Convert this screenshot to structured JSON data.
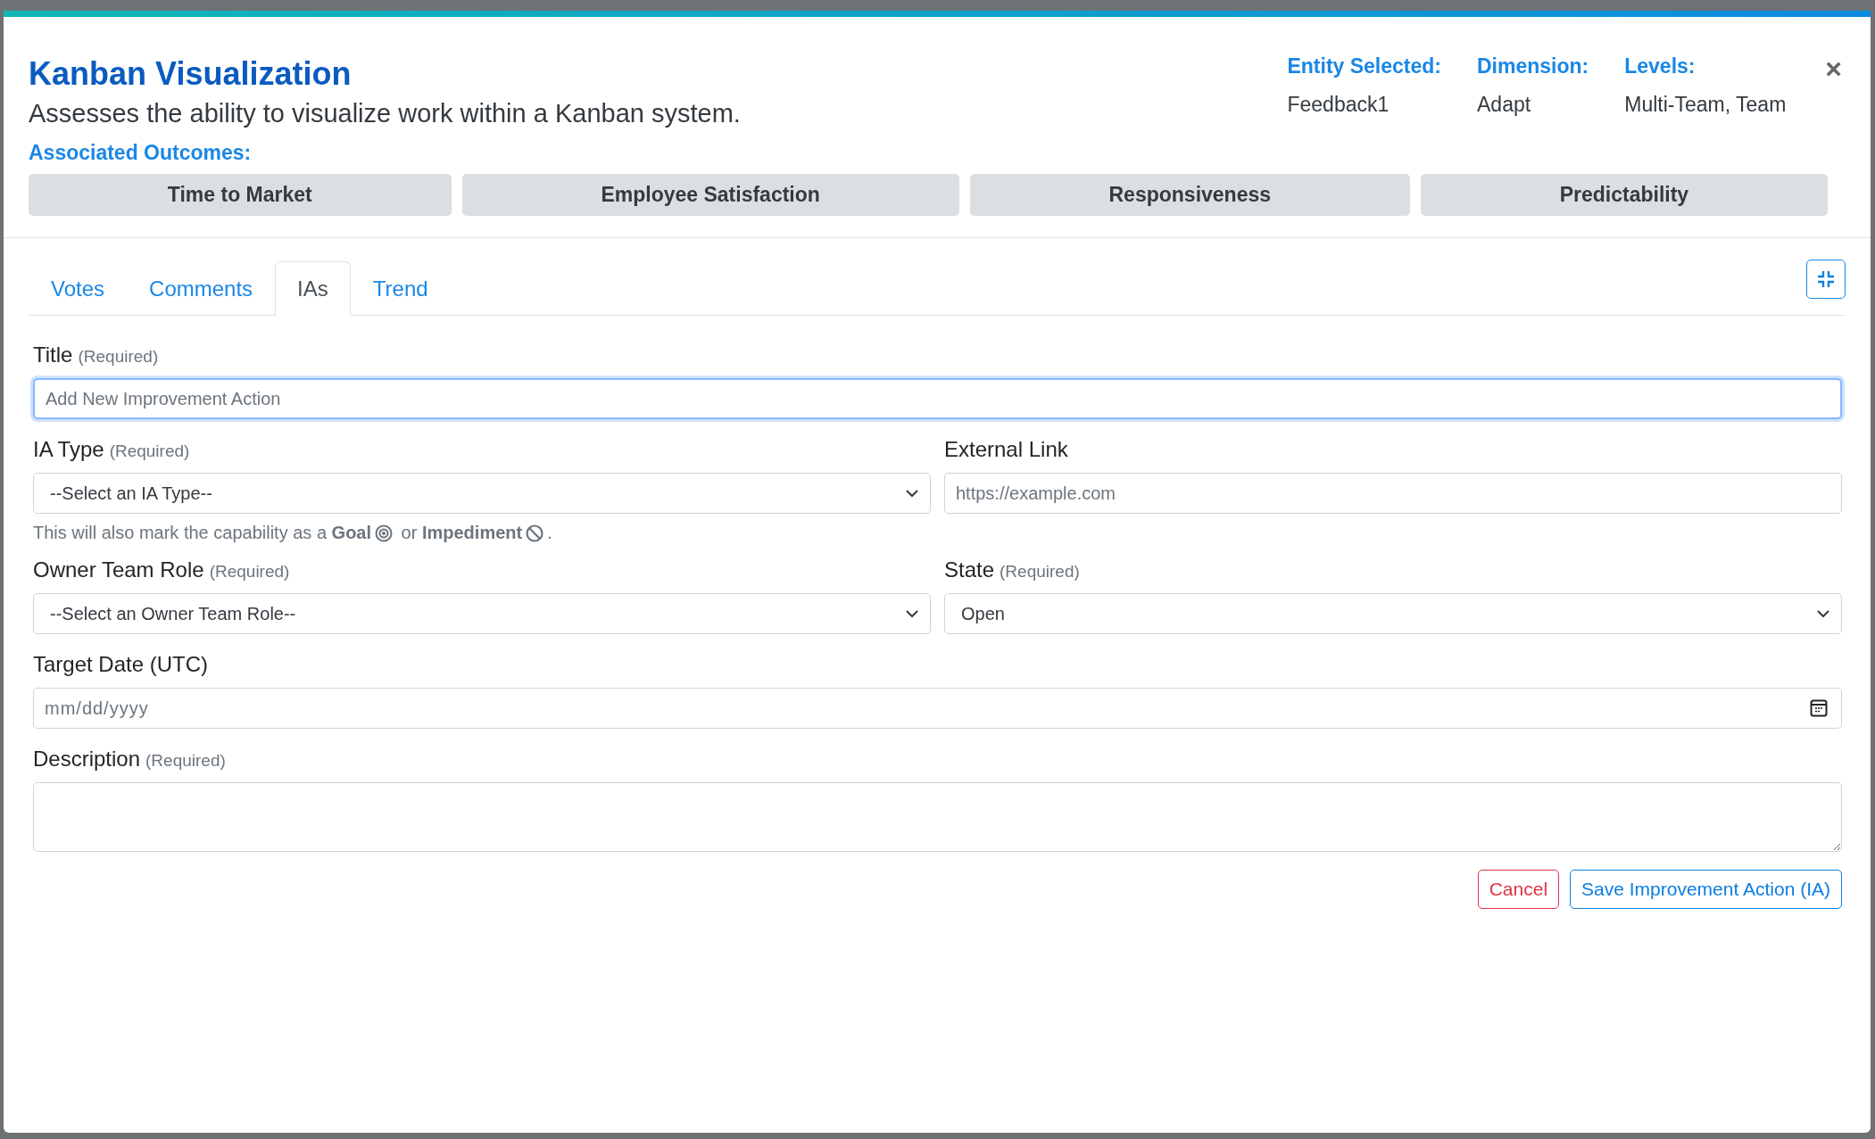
{
  "modal": {
    "title": "Kanban Visualization",
    "description": "Assesses the ability to visualize work within a Kanban system.",
    "outcomes_label": "Associated Outcomes:",
    "outcomes": [
      "Time to Market",
      "Employee Satisfaction",
      "Responsiveness",
      "Predictability"
    ],
    "meta": [
      {
        "label": "Entity Selected:",
        "value": "Feedback1"
      },
      {
        "label": "Dimension:",
        "value": "Adapt"
      },
      {
        "label": "Levels:",
        "value": "Multi-Team, Team"
      }
    ],
    "close": "×"
  },
  "tabs": [
    {
      "label": "Votes",
      "selected": false
    },
    {
      "label": "Comments",
      "selected": false
    },
    {
      "label": "IAs",
      "selected": true
    },
    {
      "label": "Trend",
      "selected": false
    }
  ],
  "form": {
    "rows": [
      [
        {
          "kind": "text",
          "label": "Title",
          "note": "(Required)",
          "placeholder": "Add New Improvement Action",
          "focused": true
        }
      ],
      [
        {
          "kind": "select",
          "label": "IA Type",
          "note": "(Required)",
          "value": "--Select an IA Type--",
          "focused": false
        },
        {
          "kind": "text",
          "label": "External Link",
          "placeholder": "https://example.com",
          "focused": false
        }
      ],
      [
        {
          "kind": "help",
          "before": "This will also mark the capability as a **Goal**",
          "middle": " or **Impediment**",
          "after": "."
        }
      ],
      [
        {
          "kind": "select",
          "label": "Owner Team Role",
          "note": "(Required)",
          "value": "--Select an Owner Team Role--",
          "focused": false
        },
        {
          "kind": "select",
          "label": "State",
          "note": "(Required)",
          "value": "Open",
          "focused": false
        }
      ],
      [
        {
          "kind": "date",
          "label": "Target Date (UTC)",
          "placeholder": "mm/dd/yyyy",
          "focused": false
        }
      ],
      [
        {
          "kind": "textarea",
          "label": "Description",
          "note": "(Required)",
          "focused": false
        }
      ]
    ],
    "cancel": "Cancel",
    "save": "Save Improvement Action (IA)"
  }
}
